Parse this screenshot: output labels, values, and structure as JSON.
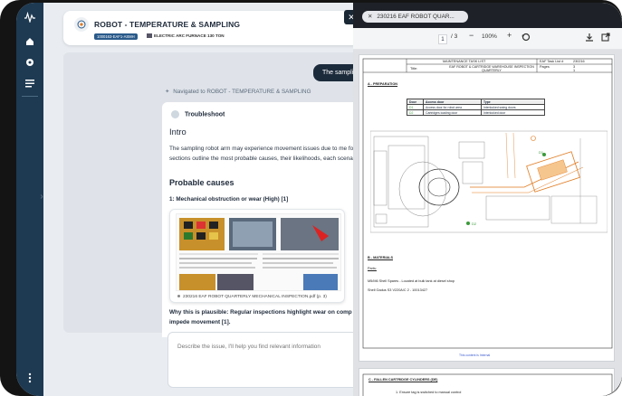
{
  "header": {
    "title": "ROBOT - TEMPERATURE & SAMPLING",
    "asset_id": "1000163-EAF1-ASMH",
    "location": "ELECTRIC ARC FURNACE 130 TON"
  },
  "chat": {
    "user_message": "The sampling",
    "navigated_note": "Navigated to ROBOT - TEMPERATURE & SAMPLING",
    "answer": {
      "section_label": "Troubleshoot",
      "intro_heading": "Intro",
      "intro_text": "The sampling robot arm may experience movement issues due to me following sections outline the most probable causes, their likelihoods, each scenario.",
      "causes_heading": "Probable causes",
      "cause_1": "1: Mechanical obstruction or wear (High) [1]",
      "preview_caption": "230216 EAF ROBOT QUARTERLY MECHANICAL INSPECTION.pdf (p. 3)",
      "plausible": "Why this is plausible: Regular inspections highlight wear on comp can impede movement [1]."
    },
    "composer_placeholder": "Describe the issue, I'll help you find relevant information"
  },
  "viewer": {
    "tab_label": "230216 EAF ROBOT QUAR...",
    "page_current": "1",
    "page_total": "/ 3",
    "zoom": "100%",
    "doc": {
      "header_title": "MAINTENANCE TASK LIST",
      "header_title_label": "Title:",
      "header_subtitle": "EAF ROBOT & CARTRIDGE WAREHOUSE INSPECTION QUARTERLY",
      "task_list_label": "EAF Task List #",
      "task_list_value": "230216",
      "pages_label": "Pages",
      "pages_value": "3",
      "page_field_value": "1",
      "section_a": "A - PREPARATION",
      "table_headers": [
        "Door",
        "Access door",
        "Type"
      ],
      "table_rows": [
        [
          "D1",
          "Access door for robot area",
          "Interlocked swing doors"
        ],
        [
          "D2",
          "Cartridges loading door",
          "Interlocked door"
        ]
      ],
      "section_b": "B - MATERIALS",
      "parts_label": "Parts:",
      "parts_line_1": "M5/M6 Shell Spares - Located at bulk tank at diesel shop",
      "parts_line_2": "Shell Gadus S3 V220A/C 2 - 10013427",
      "footer_note": "This content is Internal",
      "section_c": "C - FALLEN CARTRIDGE CYLINDERS (DE)",
      "section_c_note": "1. Ensure tag is switched to manual control"
    }
  },
  "colors": {
    "rail": "#1e3a52",
    "dark_header": "#1e2228",
    "user_bubble": "#1c2b3c",
    "accent_orange": "#e07a1f",
    "accent_green": "#3b9a3b"
  },
  "icons": [
    "logo-icon",
    "home-icon",
    "settings-icon",
    "list-icon",
    "more-icon",
    "close-icon",
    "download-icon",
    "open-external-icon",
    "rotate-icon",
    "troubleshoot-icon",
    "navigate-icon"
  ]
}
